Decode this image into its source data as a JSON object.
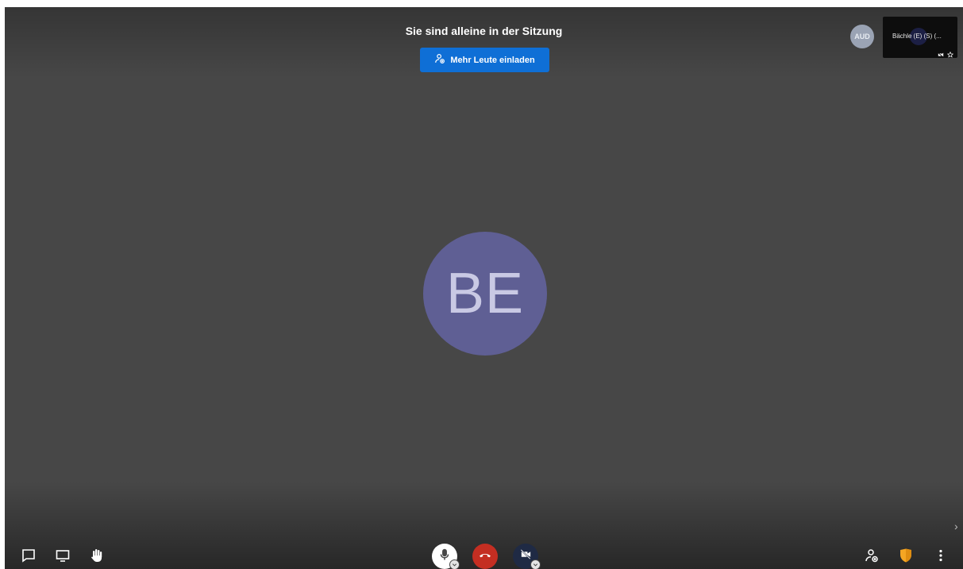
{
  "notice": {
    "title": "Sie sind alleine in der Sitzung",
    "invite_label": "Mehr Leute einladen"
  },
  "participant": {
    "initials": "BE"
  },
  "filmstrip": {
    "avatar_initials": "AUD",
    "thumbnail_name": "Bächle (E) (S) (..."
  },
  "toolbar": {
    "left": [
      "chat-icon",
      "screen-share-icon",
      "raise-hand-icon"
    ],
    "center": [
      "microphone-icon",
      "hangup-icon",
      "camera-off-icon"
    ],
    "right": [
      "invite-people-icon",
      "security-shield-icon",
      "more-options-icon"
    ]
  },
  "colors": {
    "stage": "#474747",
    "invite_button": "#0f6fd6",
    "avatar": "#5f5f94",
    "hangup": "#c42e22",
    "shield": "#f5a623"
  }
}
